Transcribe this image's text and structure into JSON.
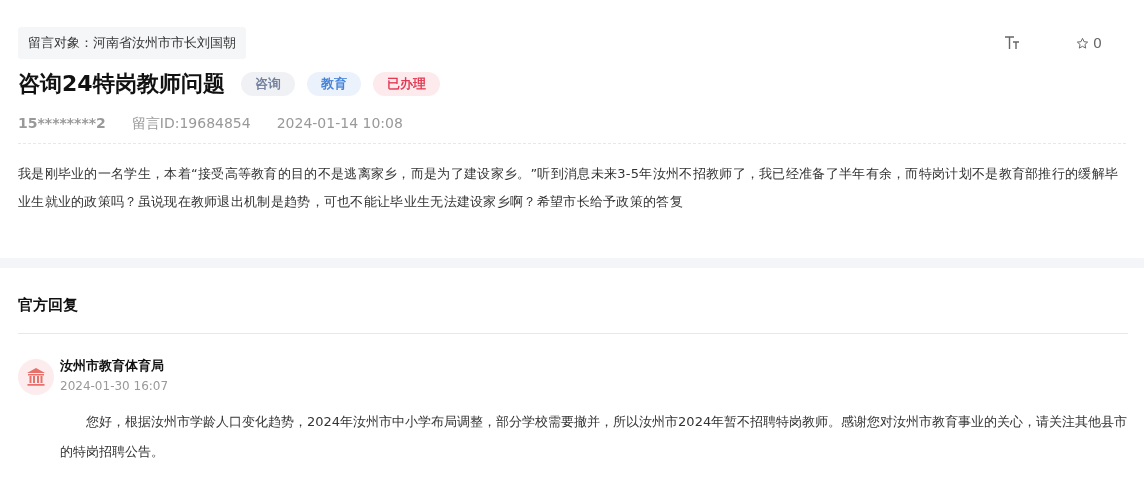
{
  "message": {
    "target": "留言对象：河南省汝州市市长刘国朝",
    "title": "咨询24特岗教师问题",
    "tags": [
      {
        "label": "咨询",
        "color": "#6b7a99"
      },
      {
        "label": "教育",
        "color": "#3a7bd5"
      },
      {
        "label": "已办理",
        "color": "#e0304a"
      }
    ],
    "favorites": "0",
    "author": "15********2",
    "message_id": "留言ID:19684854",
    "time": "2024-01-14 10:08",
    "body": "我是刚毕业的一名学生，本着“接受高等教育的目的不是逃离家乡，而是为了建设家乡。”听到消息未来3-5年汝州不招教师了，我已经准备了半年有余，而特岗计划不是教育部推行的缓解毕业生就业的政策吗？虽说现在教师退出机制是趋势，可也不能让毕业生无法建设家乡啊？希望市长给予政策的答复"
  },
  "reply": {
    "heading": "官方回复",
    "department": "汝州市教育体育局",
    "time": "2024-01-30 16:07",
    "body": "您好，根据汝州市学龄人口变化趋势，2024年汝州市中小学布局调整，部分学校需要撤并，所以汝州市2024年暂不招聘特岗教师。感谢您对汝州市教育事业的关心，请关注其他县市的特岗招聘公告。"
  }
}
